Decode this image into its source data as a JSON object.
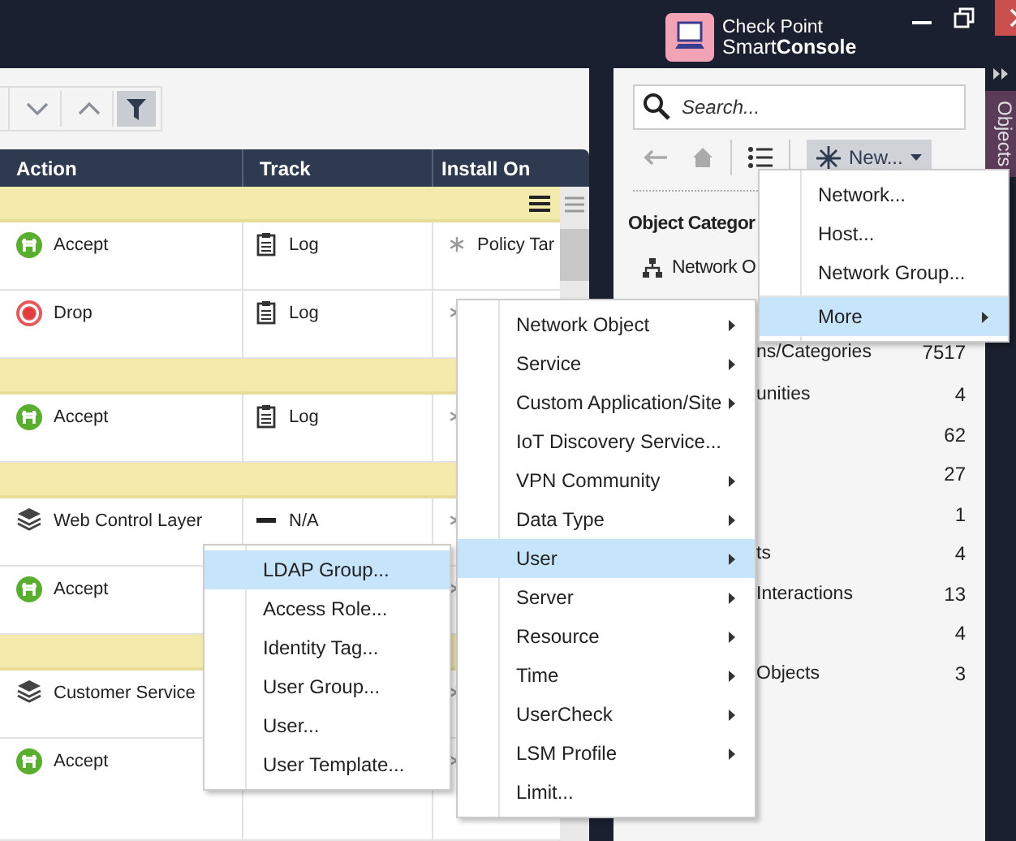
{
  "title_bar": {
    "brand_top": "Check Point",
    "brand_bottom": "Smart**Console**"
  },
  "toolbar": {
    "filter_on": true
  },
  "table": {
    "columns": [
      "Action",
      "Track",
      "Install On"
    ],
    "rows": [
      {
        "kind": "section"
      },
      {
        "kind": "rule",
        "action": {
          "kind": "accept",
          "text": "Accept"
        },
        "track": {
          "kind": "log",
          "text": "Log"
        },
        "install": "Policy Tar"
      },
      {
        "kind": "rule",
        "action": {
          "kind": "drop",
          "text": "Drop"
        },
        "track": {
          "kind": "log",
          "text": "Log"
        }
      },
      {
        "kind": "section"
      },
      {
        "kind": "rule",
        "action": {
          "kind": "accept",
          "text": "Accept"
        },
        "track": {
          "kind": "log",
          "text": "Log"
        }
      },
      {
        "kind": "section"
      },
      {
        "kind": "rule",
        "action": {
          "kind": "layer",
          "text": "Web Control Layer"
        },
        "track": {
          "kind": "none",
          "text": "N/A"
        }
      },
      {
        "kind": "rule",
        "action": {
          "kind": "accept",
          "text": "Accept"
        }
      },
      {
        "kind": "section"
      },
      {
        "kind": "rule",
        "action": {
          "kind": "layer",
          "text": "Customer Service"
        }
      },
      {
        "kind": "rule",
        "action": {
          "kind": "accept",
          "text": "Accept"
        }
      }
    ]
  },
  "objects_panel": {
    "search": {
      "placeholder": "Search..."
    },
    "new_button": "New...",
    "heading": "Object Categor",
    "categories": [
      {
        "kind": "full",
        "label": "Network O"
      },
      {
        "kind": "clipped",
        "label": "ns/Categories",
        "count": "7517"
      },
      {
        "kind": "clipped",
        "label": "unities",
        "count": "4"
      },
      {
        "kind": "clipped",
        "count": "62"
      },
      {
        "kind": "clipped",
        "count": "27"
      },
      {
        "kind": "clipped",
        "count": "1"
      },
      {
        "kind": "clipped",
        "label": "ts",
        "count": "4"
      },
      {
        "kind": "clipped",
        "label": "Interactions",
        "count": "13"
      },
      {
        "kind": "clipped",
        "count": "4"
      },
      {
        "kind": "clipped",
        "label": "Objects",
        "count": "3"
      }
    ]
  },
  "side_tab": {
    "label": "Objects"
  },
  "new_menu": [
    {
      "label": "Network...",
      "submenu": false,
      "selected": false,
      "separator_before": false
    },
    {
      "label": "Host...",
      "submenu": false,
      "selected": false,
      "separator_before": false
    },
    {
      "label": "Network Group...",
      "submenu": false,
      "selected": false,
      "separator_before": false
    },
    {
      "label": "More",
      "submenu": true,
      "selected": true,
      "separator_before": true
    }
  ],
  "new_object_menu": [
    {
      "label": "Network Object",
      "submenu": true,
      "selected": false
    },
    {
      "label": "Service",
      "submenu": true,
      "selected": false
    },
    {
      "label": "Custom Application/Site",
      "submenu": true,
      "selected": false
    },
    {
      "label": "IoT Discovery Service...",
      "submenu": false,
      "selected": false
    },
    {
      "label": "VPN Community",
      "submenu": true,
      "selected": false
    },
    {
      "label": "Data Type",
      "submenu": true,
      "selected": false
    },
    {
      "label": "User",
      "submenu": true,
      "selected": true
    },
    {
      "label": "Server",
      "submenu": true,
      "selected": false
    },
    {
      "label": "Resource",
      "submenu": true,
      "selected": false
    },
    {
      "label": "Time",
      "submenu": true,
      "selected": false
    },
    {
      "label": "UserCheck",
      "submenu": true,
      "selected": false
    },
    {
      "label": "LSM Profile",
      "submenu": true,
      "selected": false
    },
    {
      "label": "Limit...",
      "submenu": false,
      "selected": false
    }
  ],
  "user_menu": [
    {
      "label": "LDAP Group...",
      "selected": true
    },
    {
      "label": "Access Role...",
      "selected": false
    },
    {
      "label": "Identity Tag...",
      "selected": false
    },
    {
      "label": "User Group...",
      "selected": false
    },
    {
      "label": "User...",
      "selected": false
    },
    {
      "label": "User Template...",
      "selected": false
    }
  ]
}
